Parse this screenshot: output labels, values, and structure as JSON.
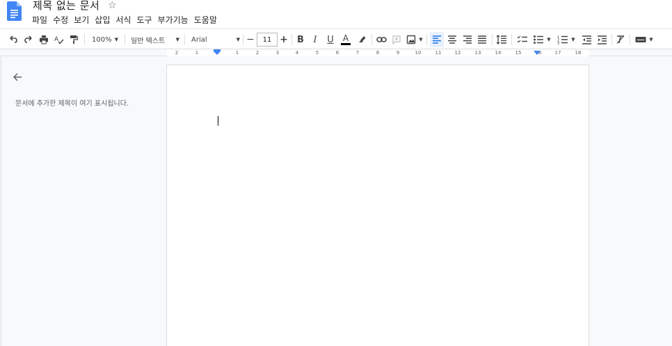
{
  "app": {
    "doc_title": "제목 없는 문서",
    "accent_color": "#4285f4"
  },
  "menu": [
    "파일",
    "수정",
    "보기",
    "삽입",
    "서식",
    "도구",
    "부가기능",
    "도움말"
  ],
  "toolbar": {
    "zoom": "100%",
    "style": "일반 텍스트",
    "font": "Arial",
    "font_size": "11",
    "icons": [
      "undo-icon",
      "redo-icon",
      "print-icon",
      "spellcheck-icon",
      "paint-format-icon",
      "bold-icon",
      "italic-icon",
      "underline-icon",
      "text-color-icon",
      "highlight-icon",
      "link-icon",
      "comment-icon",
      "image-icon",
      "align-left-icon",
      "align-center-icon",
      "align-right-icon",
      "justify-icon",
      "line-spacing-icon",
      "checklist-icon",
      "bullet-list-icon",
      "numbered-list-icon",
      "decrease-indent-icon",
      "increase-indent-icon",
      "clear-formatting-icon",
      "input-tools-icon"
    ]
  },
  "ruler": {
    "labels": [
      "2",
      "1",
      "1",
      "2",
      "3",
      "4",
      "5",
      "6",
      "7",
      "8",
      "9",
      "10",
      "11",
      "12",
      "13",
      "14",
      "15",
      "16",
      "17",
      "18"
    ]
  },
  "outline": {
    "placeholder": "문서에 추가한 제목이 여기 표시됩니다."
  }
}
